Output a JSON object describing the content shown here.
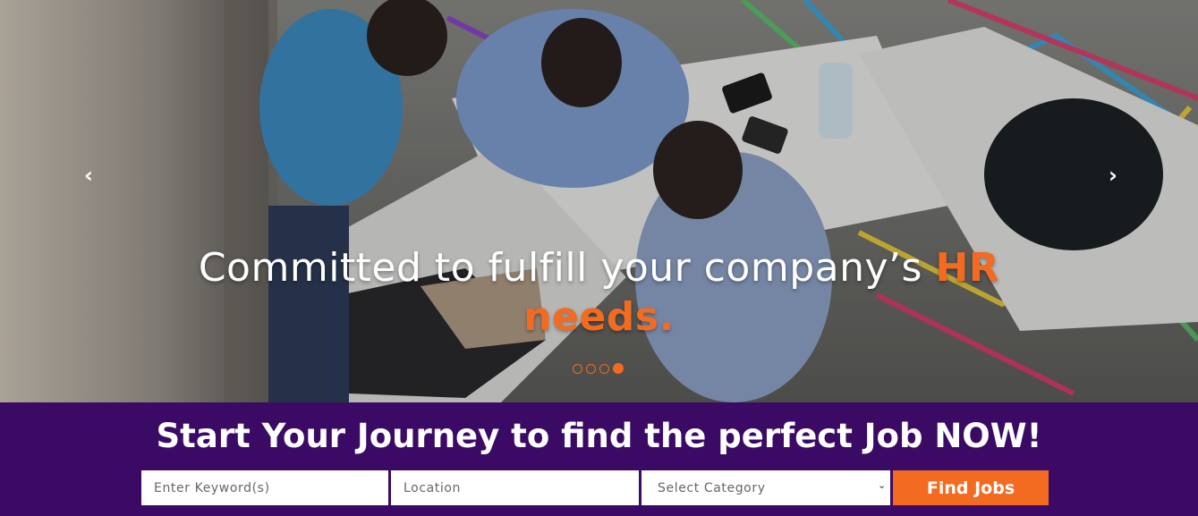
{
  "hero": {
    "prev_icon": "chevron-left-icon",
    "next_icon": "chevron-right-icon",
    "headline_part1": "Committed to fulfill your company’s ",
    "headline_accent1": "HR",
    "headline_accent2": "needs.",
    "slides": [
      {
        "active": false
      },
      {
        "active": false
      },
      {
        "active": false
      },
      {
        "active": true
      }
    ]
  },
  "search": {
    "title": "Start Your Journey to find the perfect Job NOW!",
    "keyword_placeholder": "Enter Keyword(s)",
    "location_placeholder": "Location",
    "category_selected": "Select Category",
    "submit_label": "Find Jobs"
  },
  "colors": {
    "accent": "#f26b21",
    "band": "#3a0a64"
  }
}
